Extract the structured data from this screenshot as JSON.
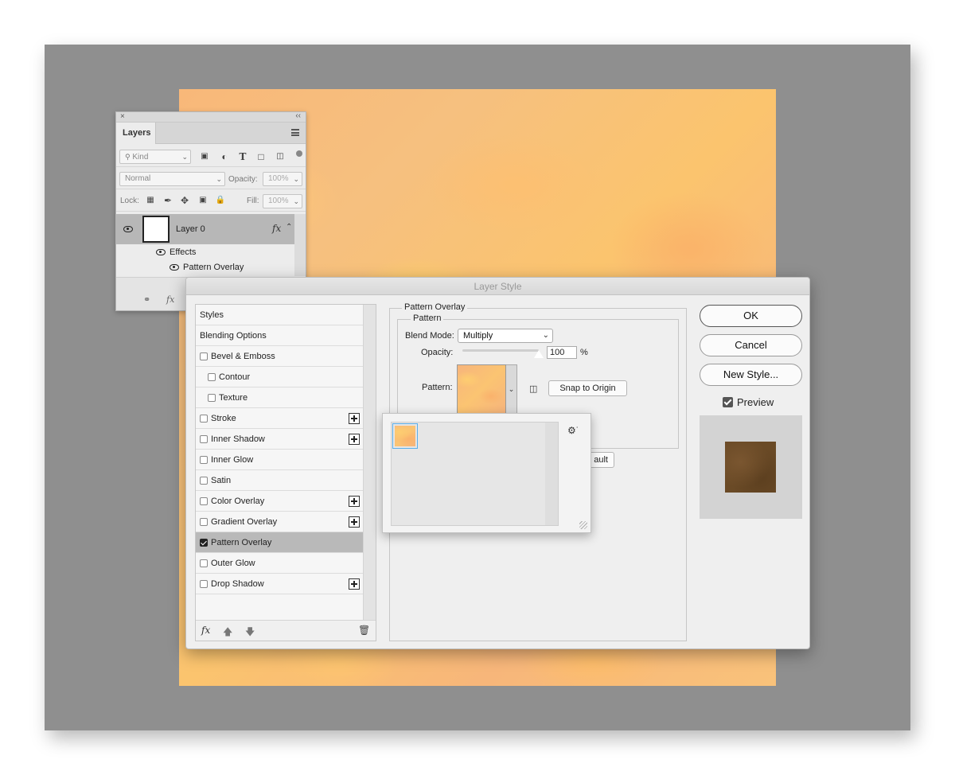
{
  "layers_panel": {
    "close": "×",
    "collapse": "‹‹",
    "tab": "Layers",
    "kind_placeholder": "Kind",
    "blend_mode": "Normal",
    "opacity_label": "Opacity:",
    "opacity_value": "100%",
    "lock_label": "Lock:",
    "fill_label": "Fill:",
    "fill_value": "100%",
    "layer_name": "Layer 0",
    "fx": "fx",
    "effects_label": "Effects",
    "effect_item": "Pattern Overlay"
  },
  "dialog": {
    "title": "Layer Style",
    "styles_list": [
      {
        "label": "Styles",
        "checkbox": false,
        "checked": false,
        "plus": false,
        "indent": false,
        "selected": false
      },
      {
        "label": "Blending Options",
        "checkbox": false,
        "checked": false,
        "plus": false,
        "indent": false,
        "selected": false
      },
      {
        "label": "Bevel & Emboss",
        "checkbox": true,
        "checked": false,
        "plus": false,
        "indent": false,
        "selected": false
      },
      {
        "label": "Contour",
        "checkbox": true,
        "checked": false,
        "plus": false,
        "indent": true,
        "selected": false
      },
      {
        "label": "Texture",
        "checkbox": true,
        "checked": false,
        "plus": false,
        "indent": true,
        "selected": false
      },
      {
        "label": "Stroke",
        "checkbox": true,
        "checked": false,
        "plus": true,
        "indent": false,
        "selected": false
      },
      {
        "label": "Inner Shadow",
        "checkbox": true,
        "checked": false,
        "plus": true,
        "indent": false,
        "selected": false
      },
      {
        "label": "Inner Glow",
        "checkbox": true,
        "checked": false,
        "plus": false,
        "indent": false,
        "selected": false
      },
      {
        "label": "Satin",
        "checkbox": true,
        "checked": false,
        "plus": false,
        "indent": false,
        "selected": false
      },
      {
        "label": "Color Overlay",
        "checkbox": true,
        "checked": false,
        "plus": true,
        "indent": false,
        "selected": false
      },
      {
        "label": "Gradient Overlay",
        "checkbox": true,
        "checked": false,
        "plus": true,
        "indent": false,
        "selected": false
      },
      {
        "label": "Pattern Overlay",
        "checkbox": true,
        "checked": true,
        "plus": false,
        "indent": false,
        "selected": true
      },
      {
        "label": "Outer Glow",
        "checkbox": true,
        "checked": false,
        "plus": false,
        "indent": false,
        "selected": false
      },
      {
        "label": "Drop Shadow",
        "checkbox": true,
        "checked": false,
        "plus": true,
        "indent": false,
        "selected": false
      }
    ],
    "footer_fx": "fx",
    "section_title": "Pattern Overlay",
    "group_title": "Pattern",
    "blend_mode_label": "Blend Mode:",
    "blend_mode_value": "Multiply",
    "opacity_label": "Opacity:",
    "opacity_value": "100",
    "opacity_unit": "%",
    "opacity_level": 1.0,
    "pattern_label": "Pattern:",
    "snap_button": "Snap to Origin",
    "default_button_partial": "ault",
    "ok": "OK",
    "cancel": "Cancel",
    "new_style": "New Style...",
    "preview_label": "Preview",
    "preview_checked": true
  },
  "colors": {
    "workspace": "#8f8f8f",
    "selected_row": "#b9b9b9",
    "picker_selection": "#5aaeea",
    "preview_swatch": "#6a4a26"
  }
}
